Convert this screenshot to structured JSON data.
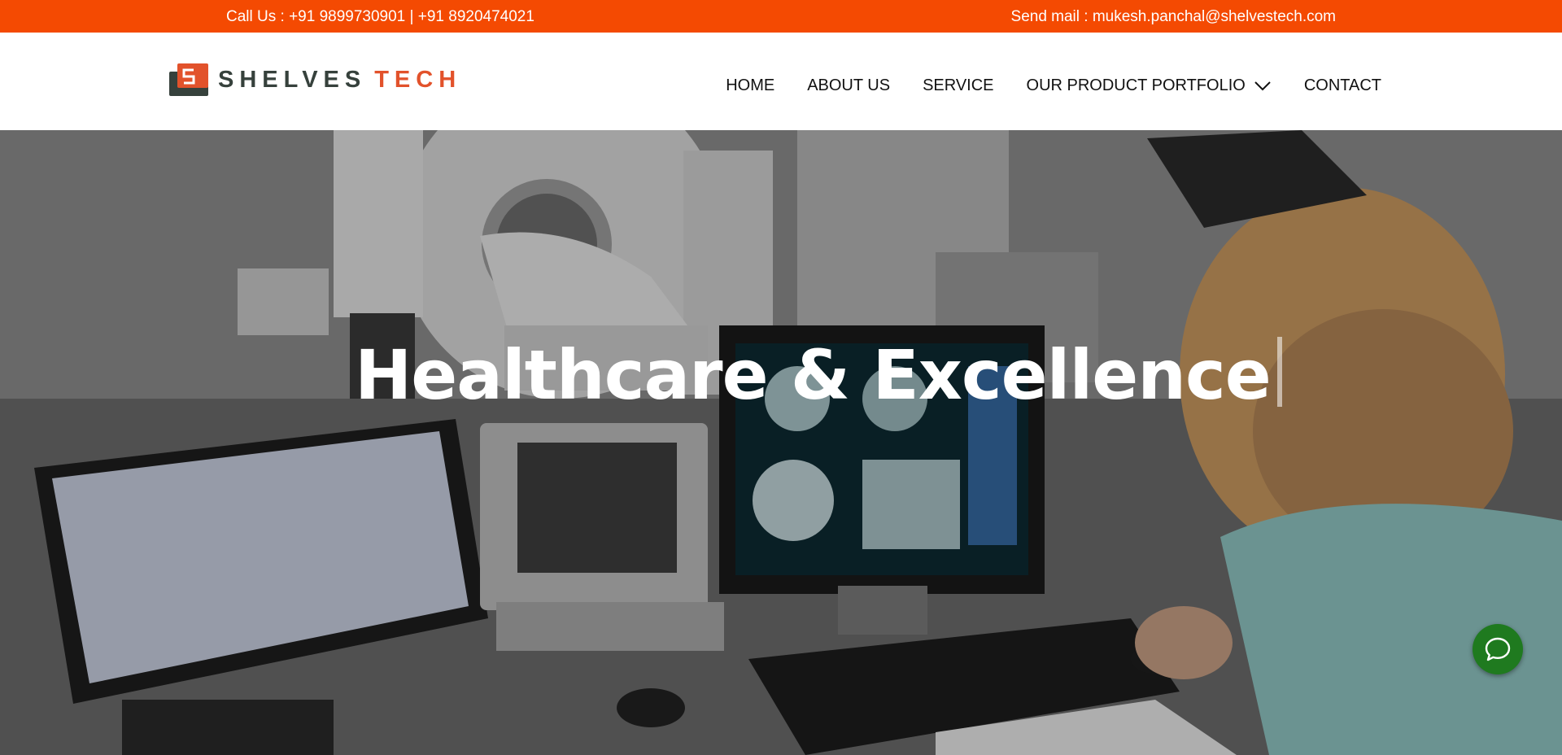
{
  "colors": {
    "accent": "#f44a02",
    "logo_dark": "#36413c",
    "logo_red": "#e2522b",
    "chat": "#1f7a1f"
  },
  "topbar": {
    "call": "Call Us : +91 9899730901 | +91 8920474021",
    "mail": "Send mail : mukesh.panchal@shelvestech.com"
  },
  "logo": {
    "word1": "SHELVES",
    "word2": "TECH",
    "icon": "shelves-tech-logo-icon"
  },
  "nav": {
    "home": "HOME",
    "about": "ABOUT US",
    "service": "SERVICE",
    "portfolio": "OUR PRODUCT PORTFOLIO",
    "contact": "CONTACT",
    "dropdown_icon": "chevron-down-icon"
  },
  "hero": {
    "title": "Healthcare & Excellence"
  },
  "chat": {
    "icon": "chat-bubble-icon"
  }
}
